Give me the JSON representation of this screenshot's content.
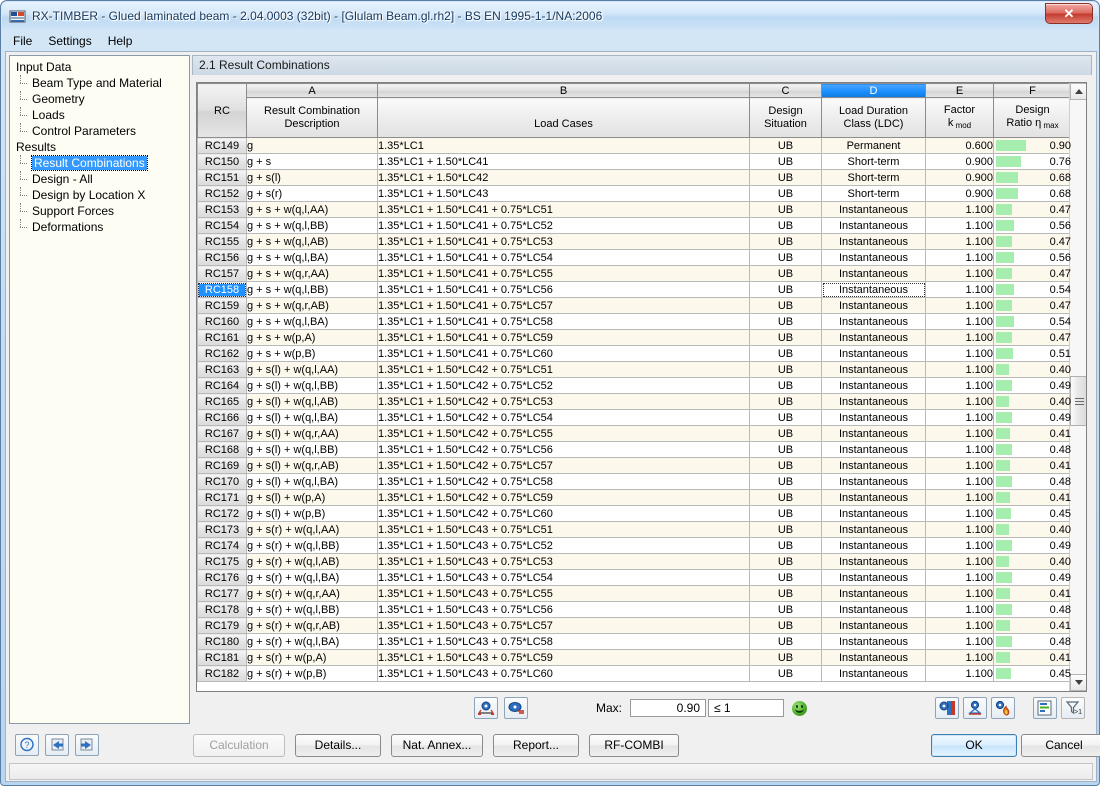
{
  "window": {
    "title": "RX-TIMBER - Glued laminated beam - 2.04.0003 (32bit) - [Glulam Beam.gl.rh2] - BS EN 1995-1-1/NA:2006",
    "app_icon": "rx-timber-icon",
    "close_label": "✕"
  },
  "menubar": {
    "items": [
      "File",
      "Settings",
      "Help"
    ]
  },
  "tree": {
    "nodes": [
      {
        "label": "Input Data",
        "type": "root",
        "selected": false
      },
      {
        "label": "Beam Type and Material",
        "type": "child",
        "selected": false
      },
      {
        "label": "Geometry",
        "type": "child",
        "selected": false
      },
      {
        "label": "Loads",
        "type": "child",
        "selected": false
      },
      {
        "label": "Control Parameters",
        "type": "child",
        "selected": false
      },
      {
        "label": "Results",
        "type": "root",
        "selected": false
      },
      {
        "label": "Result Combinations",
        "type": "child",
        "selected": true
      },
      {
        "label": "Design - All",
        "type": "child",
        "selected": false
      },
      {
        "label": "Design by Location X",
        "type": "child",
        "selected": false
      },
      {
        "label": "Support Forces",
        "type": "child",
        "selected": false
      },
      {
        "label": "Deformations",
        "type": "child",
        "selected": false
      }
    ]
  },
  "section": {
    "title": "2.1 Result Combinations"
  },
  "table": {
    "column_letters": [
      "",
      "A",
      "B",
      "C",
      "D",
      "E",
      "F"
    ],
    "selected_column_letter": "D",
    "headers": {
      "rc": "RC",
      "a": [
        "Result Combination",
        "Description"
      ],
      "b": [
        "",
        "Load Cases"
      ],
      "c": [
        "Design",
        "Situation"
      ],
      "d": [
        "Load Duration",
        "Class (LDC)"
      ],
      "e": [
        "Factor",
        "k mod"
      ],
      "f": [
        "Design",
        "Ratio η max"
      ]
    },
    "selected_row_id": "RC158",
    "focused_cell": {
      "row": "RC158",
      "column": "D"
    },
    "rows": [
      {
        "rc": "RC149",
        "desc": "g",
        "cases": "1.35*LC1",
        "situation": "UB",
        "ldc": "Permanent",
        "kmod": "0.600",
        "ratio": "0.90"
      },
      {
        "rc": "RC150",
        "desc": "g + s",
        "cases": "1.35*LC1 + 1.50*LC41",
        "situation": "UB",
        "ldc": "Short-term",
        "kmod": "0.900",
        "ratio": "0.76"
      },
      {
        "rc": "RC151",
        "desc": "g + s(l)",
        "cases": "1.35*LC1 + 1.50*LC42",
        "situation": "UB",
        "ldc": "Short-term",
        "kmod": "0.900",
        "ratio": "0.68"
      },
      {
        "rc": "RC152",
        "desc": "g + s(r)",
        "cases": "1.35*LC1 + 1.50*LC43",
        "situation": "UB",
        "ldc": "Short-term",
        "kmod": "0.900",
        "ratio": "0.68"
      },
      {
        "rc": "RC153",
        "desc": "g + s + w(q,l,AA)",
        "cases": "1.35*LC1 + 1.50*LC41 + 0.75*LC51",
        "situation": "UB",
        "ldc": "Instantaneous",
        "kmod": "1.100",
        "ratio": "0.47"
      },
      {
        "rc": "RC154",
        "desc": "g + s + w(q,l,BB)",
        "cases": "1.35*LC1 + 1.50*LC41 + 0.75*LC52",
        "situation": "UB",
        "ldc": "Instantaneous",
        "kmod": "1.100",
        "ratio": "0.56"
      },
      {
        "rc": "RC155",
        "desc": "g + s + w(q,l,AB)",
        "cases": "1.35*LC1 + 1.50*LC41 + 0.75*LC53",
        "situation": "UB",
        "ldc": "Instantaneous",
        "kmod": "1.100",
        "ratio": "0.47"
      },
      {
        "rc": "RC156",
        "desc": "g + s + w(q,l,BA)",
        "cases": "1.35*LC1 + 1.50*LC41 + 0.75*LC54",
        "situation": "UB",
        "ldc": "Instantaneous",
        "kmod": "1.100",
        "ratio": "0.56"
      },
      {
        "rc": "RC157",
        "desc": "g + s + w(q,r,AA)",
        "cases": "1.35*LC1 + 1.50*LC41 + 0.75*LC55",
        "situation": "UB",
        "ldc": "Instantaneous",
        "kmod": "1.100",
        "ratio": "0.47"
      },
      {
        "rc": "RC158",
        "desc": "g + s + w(q,l,BB)",
        "cases": "1.35*LC1 + 1.50*LC41 + 0.75*LC56",
        "situation": "UB",
        "ldc": "Instantaneous",
        "kmod": "1.100",
        "ratio": "0.54"
      },
      {
        "rc": "RC159",
        "desc": "g + s + w(q,r,AB)",
        "cases": "1.35*LC1 + 1.50*LC41 + 0.75*LC57",
        "situation": "UB",
        "ldc": "Instantaneous",
        "kmod": "1.100",
        "ratio": "0.47"
      },
      {
        "rc": "RC160",
        "desc": "g + s + w(q,l,BA)",
        "cases": "1.35*LC1 + 1.50*LC41 + 0.75*LC58",
        "situation": "UB",
        "ldc": "Instantaneous",
        "kmod": "1.100",
        "ratio": "0.54"
      },
      {
        "rc": "RC161",
        "desc": "g + s + w(p,A)",
        "cases": "1.35*LC1 + 1.50*LC41 + 0.75*LC59",
        "situation": "UB",
        "ldc": "Instantaneous",
        "kmod": "1.100",
        "ratio": "0.47"
      },
      {
        "rc": "RC162",
        "desc": "g + s + w(p,B)",
        "cases": "1.35*LC1 + 1.50*LC41 + 0.75*LC60",
        "situation": "UB",
        "ldc": "Instantaneous",
        "kmod": "1.100",
        "ratio": "0.51"
      },
      {
        "rc": "RC163",
        "desc": "g + s(l) + w(q,l,AA)",
        "cases": "1.35*LC1 + 1.50*LC42 + 0.75*LC51",
        "situation": "UB",
        "ldc": "Instantaneous",
        "kmod": "1.100",
        "ratio": "0.40"
      },
      {
        "rc": "RC164",
        "desc": "g + s(l) + w(q,l,BB)",
        "cases": "1.35*LC1 + 1.50*LC42 + 0.75*LC52",
        "situation": "UB",
        "ldc": "Instantaneous",
        "kmod": "1.100",
        "ratio": "0.49"
      },
      {
        "rc": "RC165",
        "desc": "g + s(l) + w(q,l,AB)",
        "cases": "1.35*LC1 + 1.50*LC42 + 0.75*LC53",
        "situation": "UB",
        "ldc": "Instantaneous",
        "kmod": "1.100",
        "ratio": "0.40"
      },
      {
        "rc": "RC166",
        "desc": "g + s(l) + w(q,l,BA)",
        "cases": "1.35*LC1 + 1.50*LC42 + 0.75*LC54",
        "situation": "UB",
        "ldc": "Instantaneous",
        "kmod": "1.100",
        "ratio": "0.49"
      },
      {
        "rc": "RC167",
        "desc": "g + s(l) + w(q,r,AA)",
        "cases": "1.35*LC1 + 1.50*LC42 + 0.75*LC55",
        "situation": "UB",
        "ldc": "Instantaneous",
        "kmod": "1.100",
        "ratio": "0.41"
      },
      {
        "rc": "RC168",
        "desc": "g + s(l) + w(q,l,BB)",
        "cases": "1.35*LC1 + 1.50*LC42 + 0.75*LC56",
        "situation": "UB",
        "ldc": "Instantaneous",
        "kmod": "1.100",
        "ratio": "0.48"
      },
      {
        "rc": "RC169",
        "desc": "g + s(l) + w(q,r,AB)",
        "cases": "1.35*LC1 + 1.50*LC42 + 0.75*LC57",
        "situation": "UB",
        "ldc": "Instantaneous",
        "kmod": "1.100",
        "ratio": "0.41"
      },
      {
        "rc": "RC170",
        "desc": "g + s(l) + w(q,l,BA)",
        "cases": "1.35*LC1 + 1.50*LC42 + 0.75*LC58",
        "situation": "UB",
        "ldc": "Instantaneous",
        "kmod": "1.100",
        "ratio": "0.48"
      },
      {
        "rc": "RC171",
        "desc": "g + s(l) + w(p,A)",
        "cases": "1.35*LC1 + 1.50*LC42 + 0.75*LC59",
        "situation": "UB",
        "ldc": "Instantaneous",
        "kmod": "1.100",
        "ratio": "0.41"
      },
      {
        "rc": "RC172",
        "desc": "g + s(l) + w(p,B)",
        "cases": "1.35*LC1 + 1.50*LC42 + 0.75*LC60",
        "situation": "UB",
        "ldc": "Instantaneous",
        "kmod": "1.100",
        "ratio": "0.45"
      },
      {
        "rc": "RC173",
        "desc": "g + s(r) + w(q,l,AA)",
        "cases": "1.35*LC1 + 1.50*LC43 + 0.75*LC51",
        "situation": "UB",
        "ldc": "Instantaneous",
        "kmod": "1.100",
        "ratio": "0.40"
      },
      {
        "rc": "RC174",
        "desc": "g + s(r) + w(q,l,BB)",
        "cases": "1.35*LC1 + 1.50*LC43 + 0.75*LC52",
        "situation": "UB",
        "ldc": "Instantaneous",
        "kmod": "1.100",
        "ratio": "0.49"
      },
      {
        "rc": "RC175",
        "desc": "g + s(r) + w(q,l,AB)",
        "cases": "1.35*LC1 + 1.50*LC43 + 0.75*LC53",
        "situation": "UB",
        "ldc": "Instantaneous",
        "kmod": "1.100",
        "ratio": "0.40"
      },
      {
        "rc": "RC176",
        "desc": "g + s(r) + w(q,l,BA)",
        "cases": "1.35*LC1 + 1.50*LC43 + 0.75*LC54",
        "situation": "UB",
        "ldc": "Instantaneous",
        "kmod": "1.100",
        "ratio": "0.49"
      },
      {
        "rc": "RC177",
        "desc": "g + s(r) + w(q,r,AA)",
        "cases": "1.35*LC1 + 1.50*LC43 + 0.75*LC55",
        "situation": "UB",
        "ldc": "Instantaneous",
        "kmod": "1.100",
        "ratio": "0.41"
      },
      {
        "rc": "RC178",
        "desc": "g + s(r) + w(q,l,BB)",
        "cases": "1.35*LC1 + 1.50*LC43 + 0.75*LC56",
        "situation": "UB",
        "ldc": "Instantaneous",
        "kmod": "1.100",
        "ratio": "0.48"
      },
      {
        "rc": "RC179",
        "desc": "g + s(r) + w(q,r,AB)",
        "cases": "1.35*LC1 + 1.50*LC43 + 0.75*LC57",
        "situation": "UB",
        "ldc": "Instantaneous",
        "kmod": "1.100",
        "ratio": "0.41"
      },
      {
        "rc": "RC180",
        "desc": "g + s(r) + w(q,l,BA)",
        "cases": "1.35*LC1 + 1.50*LC43 + 0.75*LC58",
        "situation": "UB",
        "ldc": "Instantaneous",
        "kmod": "1.100",
        "ratio": "0.48"
      },
      {
        "rc": "RC181",
        "desc": "g + s(r) + w(p,A)",
        "cases": "1.35*LC1 + 1.50*LC43 + 0.75*LC59",
        "situation": "UB",
        "ldc": "Instantaneous",
        "kmod": "1.100",
        "ratio": "0.41"
      },
      {
        "rc": "RC182",
        "desc": "g + s(r) + w(p,B)",
        "cases": "1.35*LC1 + 1.50*LC43 + 0.75*LC60",
        "situation": "UB",
        "ldc": "Instantaneous",
        "kmod": "1.100",
        "ratio": "0.45"
      }
    ]
  },
  "table_toolbar": {
    "left_buttons": [
      {
        "icon": "loads-view-icon"
      },
      {
        "icon": "supports-view-icon"
      }
    ],
    "max_label": "Max:",
    "max_value": "0.90",
    "max_limit": "≤ 1",
    "status_icon": "green-smiley-icon",
    "right_buttons": [
      {
        "icon": "climate-view-icon"
      },
      {
        "icon": "support-view-icon"
      },
      {
        "icon": "fire-design-icon"
      },
      {
        "icon": "result-chart-icon"
      },
      {
        "icon": "filter-gt1-icon"
      }
    ]
  },
  "buttons": {
    "help": "help-icon",
    "prev": "back-arrow-icon",
    "next": "forward-arrow-icon",
    "calculation": "Calculation",
    "details": "Details...",
    "nat_annex": "Nat. Annex...",
    "report": "Report...",
    "rf_combi": "RF-COMBI",
    "ok": "OK",
    "cancel": "Cancel"
  },
  "colors": {
    "accent": "#1e90ff",
    "ratio_bar": "#a6eeb0",
    "title_text": "#14375e",
    "row_alt": "#fdf8ec"
  }
}
